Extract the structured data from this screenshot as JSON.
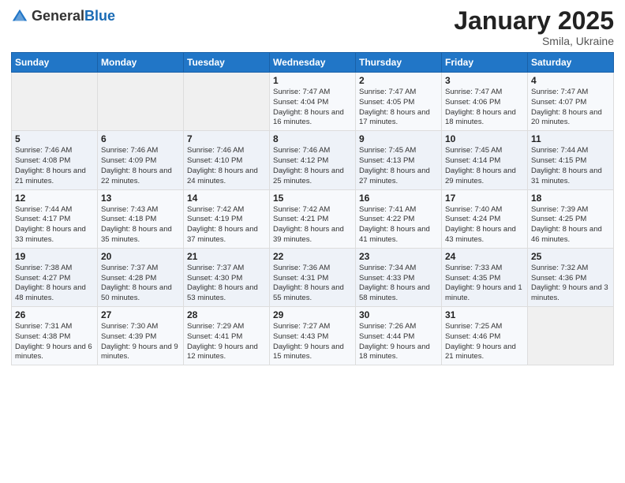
{
  "header": {
    "logo_general": "General",
    "logo_blue": "Blue",
    "month_title": "January 2025",
    "subtitle": "Smila, Ukraine"
  },
  "weekdays": [
    "Sunday",
    "Monday",
    "Tuesday",
    "Wednesday",
    "Thursday",
    "Friday",
    "Saturday"
  ],
  "weeks": [
    [
      {
        "day": "",
        "info": ""
      },
      {
        "day": "",
        "info": ""
      },
      {
        "day": "",
        "info": ""
      },
      {
        "day": "1",
        "info": "Sunrise: 7:47 AM\nSunset: 4:04 PM\nDaylight: 8 hours and 16 minutes."
      },
      {
        "day": "2",
        "info": "Sunrise: 7:47 AM\nSunset: 4:05 PM\nDaylight: 8 hours and 17 minutes."
      },
      {
        "day": "3",
        "info": "Sunrise: 7:47 AM\nSunset: 4:06 PM\nDaylight: 8 hours and 18 minutes."
      },
      {
        "day": "4",
        "info": "Sunrise: 7:47 AM\nSunset: 4:07 PM\nDaylight: 8 hours and 20 minutes."
      }
    ],
    [
      {
        "day": "5",
        "info": "Sunrise: 7:46 AM\nSunset: 4:08 PM\nDaylight: 8 hours and 21 minutes."
      },
      {
        "day": "6",
        "info": "Sunrise: 7:46 AM\nSunset: 4:09 PM\nDaylight: 8 hours and 22 minutes."
      },
      {
        "day": "7",
        "info": "Sunrise: 7:46 AM\nSunset: 4:10 PM\nDaylight: 8 hours and 24 minutes."
      },
      {
        "day": "8",
        "info": "Sunrise: 7:46 AM\nSunset: 4:12 PM\nDaylight: 8 hours and 25 minutes."
      },
      {
        "day": "9",
        "info": "Sunrise: 7:45 AM\nSunset: 4:13 PM\nDaylight: 8 hours and 27 minutes."
      },
      {
        "day": "10",
        "info": "Sunrise: 7:45 AM\nSunset: 4:14 PM\nDaylight: 8 hours and 29 minutes."
      },
      {
        "day": "11",
        "info": "Sunrise: 7:44 AM\nSunset: 4:15 PM\nDaylight: 8 hours and 31 minutes."
      }
    ],
    [
      {
        "day": "12",
        "info": "Sunrise: 7:44 AM\nSunset: 4:17 PM\nDaylight: 8 hours and 33 minutes."
      },
      {
        "day": "13",
        "info": "Sunrise: 7:43 AM\nSunset: 4:18 PM\nDaylight: 8 hours and 35 minutes."
      },
      {
        "day": "14",
        "info": "Sunrise: 7:42 AM\nSunset: 4:19 PM\nDaylight: 8 hours and 37 minutes."
      },
      {
        "day": "15",
        "info": "Sunrise: 7:42 AM\nSunset: 4:21 PM\nDaylight: 8 hours and 39 minutes."
      },
      {
        "day": "16",
        "info": "Sunrise: 7:41 AM\nSunset: 4:22 PM\nDaylight: 8 hours and 41 minutes."
      },
      {
        "day": "17",
        "info": "Sunrise: 7:40 AM\nSunset: 4:24 PM\nDaylight: 8 hours and 43 minutes."
      },
      {
        "day": "18",
        "info": "Sunrise: 7:39 AM\nSunset: 4:25 PM\nDaylight: 8 hours and 46 minutes."
      }
    ],
    [
      {
        "day": "19",
        "info": "Sunrise: 7:38 AM\nSunset: 4:27 PM\nDaylight: 8 hours and 48 minutes."
      },
      {
        "day": "20",
        "info": "Sunrise: 7:37 AM\nSunset: 4:28 PM\nDaylight: 8 hours and 50 minutes."
      },
      {
        "day": "21",
        "info": "Sunrise: 7:37 AM\nSunset: 4:30 PM\nDaylight: 8 hours and 53 minutes."
      },
      {
        "day": "22",
        "info": "Sunrise: 7:36 AM\nSunset: 4:31 PM\nDaylight: 8 hours and 55 minutes."
      },
      {
        "day": "23",
        "info": "Sunrise: 7:34 AM\nSunset: 4:33 PM\nDaylight: 8 hours and 58 minutes."
      },
      {
        "day": "24",
        "info": "Sunrise: 7:33 AM\nSunset: 4:35 PM\nDaylight: 9 hours and 1 minute."
      },
      {
        "day": "25",
        "info": "Sunrise: 7:32 AM\nSunset: 4:36 PM\nDaylight: 9 hours and 3 minutes."
      }
    ],
    [
      {
        "day": "26",
        "info": "Sunrise: 7:31 AM\nSunset: 4:38 PM\nDaylight: 9 hours and 6 minutes."
      },
      {
        "day": "27",
        "info": "Sunrise: 7:30 AM\nSunset: 4:39 PM\nDaylight: 9 hours and 9 minutes."
      },
      {
        "day": "28",
        "info": "Sunrise: 7:29 AM\nSunset: 4:41 PM\nDaylight: 9 hours and 12 minutes."
      },
      {
        "day": "29",
        "info": "Sunrise: 7:27 AM\nSunset: 4:43 PM\nDaylight: 9 hours and 15 minutes."
      },
      {
        "day": "30",
        "info": "Sunrise: 7:26 AM\nSunset: 4:44 PM\nDaylight: 9 hours and 18 minutes."
      },
      {
        "day": "31",
        "info": "Sunrise: 7:25 AM\nSunset: 4:46 PM\nDaylight: 9 hours and 21 minutes."
      },
      {
        "day": "",
        "info": ""
      }
    ]
  ]
}
